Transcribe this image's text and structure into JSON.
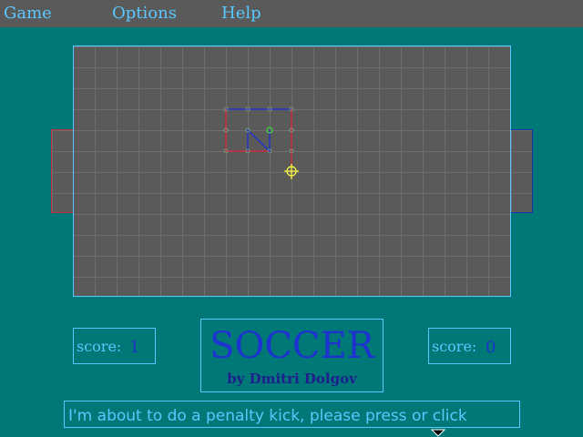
{
  "menu": {
    "items": [
      "Game",
      "Options",
      "Help"
    ]
  },
  "scores": {
    "left": {
      "label": "score:",
      "value": "1"
    },
    "right": {
      "label": "score:",
      "value": "0"
    }
  },
  "title": {
    "name": "SOCCER",
    "author": "by Dmitri Dolgov"
  },
  "status": {
    "message": "I'm about to do a penalty kick, please press or click"
  },
  "colors": {
    "background": "#007878",
    "field": "#5a5a5a",
    "grid_line": "#6e6e6e",
    "border_cyan": "#5ac8ff",
    "player1_red": "#c8283c",
    "player2_blue": "#1e32a0",
    "ball_yellow": "#ffff3c"
  }
}
